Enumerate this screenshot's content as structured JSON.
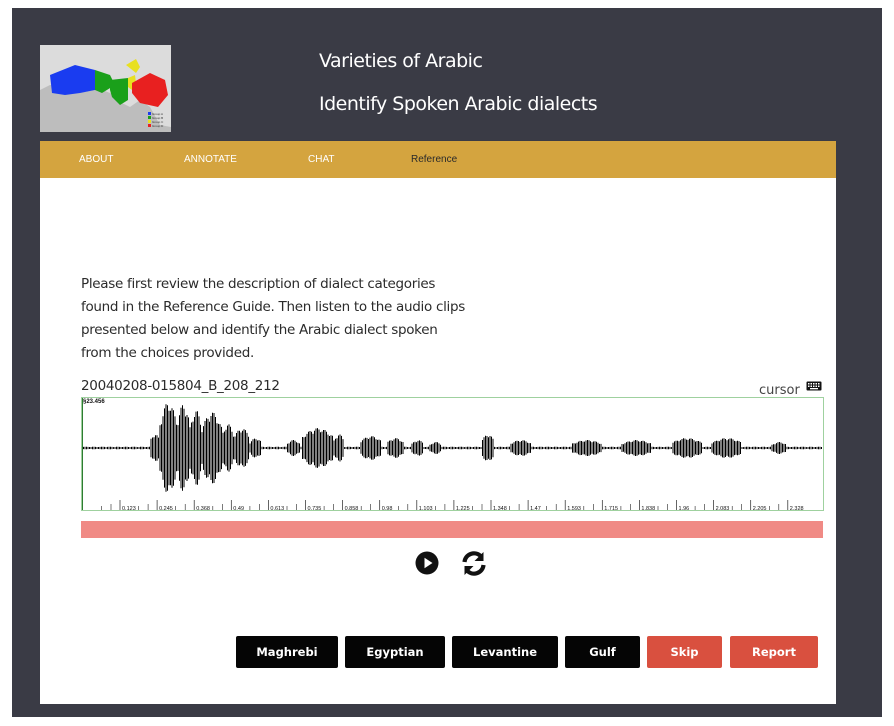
{
  "header": {
    "title": "Varieties of Arabic",
    "subtitle": "Identify Spoken Arabic dialects",
    "map_legend": [
      "Group A",
      "Group B",
      "Group C",
      "Group D"
    ]
  },
  "nav": {
    "items": [
      {
        "label": "ABOUT"
      },
      {
        "label": "ANNOTATE"
      },
      {
        "label": "CHAT"
      },
      {
        "label": "Reference"
      }
    ],
    "active": "Reference"
  },
  "main": {
    "description": "Please first review the description of dialect categories found in the Reference Guide. Then listen to the audio clips presented below and identify the Arabic dialect spoken from the choices provided.",
    "clip_id": "20040208-015804_B_208_212",
    "cursor_label": "cursor",
    "cursor_time": "§23.456",
    "time_ticks": [
      "0.123",
      "0.245",
      "0.368",
      "0.49",
      "0.613",
      "0.735",
      "0.858",
      "0.98",
      "1.103",
      "1.225",
      "1.348",
      "1.47",
      "1.593",
      "1.715",
      "1.838",
      "1.96",
      "2.083",
      "2.205",
      "2.328"
    ],
    "icons": {
      "play": "play-icon",
      "replay": "refresh-icon",
      "keyboard": "keyboard-icon"
    }
  },
  "choices": {
    "maghrebi": "Maghrebi",
    "egyptian": "Egyptian",
    "levantine": "Levantine",
    "gulf": "Gulf",
    "skip": "Skip",
    "report": "Report"
  },
  "colors": {
    "background": "#3a3b45",
    "navbar": "#d4a43f",
    "waveform_bar": "#f08a85",
    "danger": "#d9503f",
    "group_a": "#1a3cf0",
    "group_b": "#1aa01a",
    "group_c": "#e8e020",
    "group_d": "#e82020"
  }
}
